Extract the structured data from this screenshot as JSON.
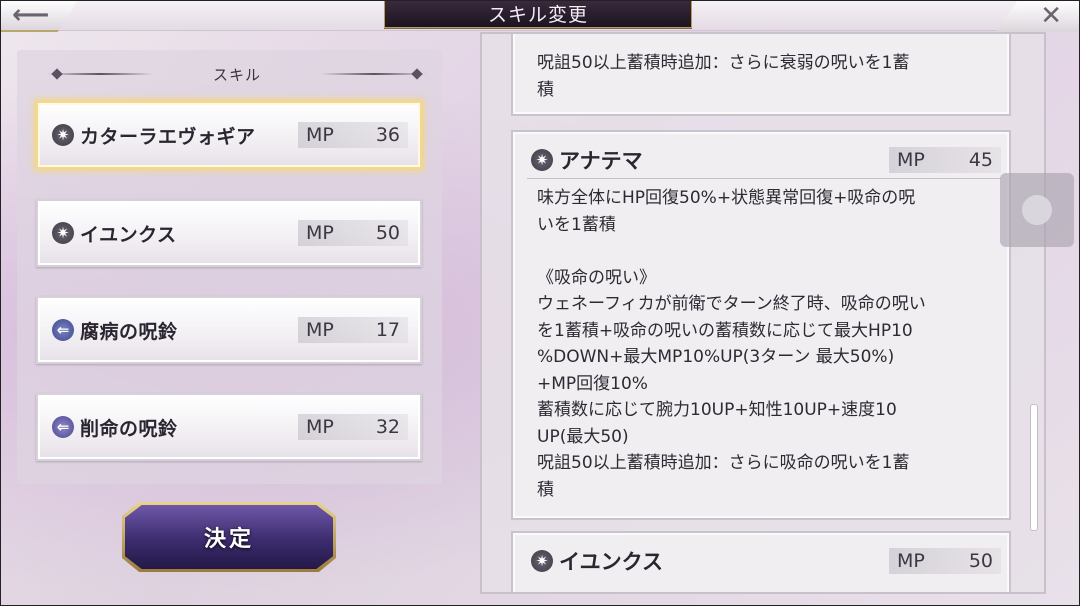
{
  "header": {
    "back_icon": "back-arrow-icon",
    "title": "スキル変更",
    "close_icon": "close-x-icon"
  },
  "left": {
    "section_title": "スキル",
    "skills": [
      {
        "name": "カターラエヴォギア",
        "mp_label": "MP",
        "mp": "36",
        "icon": "star-emblem-icon",
        "selected": true
      },
      {
        "name": "イユンクス",
        "mp_label": "MP",
        "mp": "50",
        "icon": "star-emblem-icon",
        "selected": false
      },
      {
        "name": "腐病の呪鈴",
        "mp_label": "MP",
        "mp": "17",
        "icon": "arrow-left-icon",
        "selected": false
      },
      {
        "name": "削命の呪鈴",
        "mp_label": "MP",
        "mp": "32",
        "icon": "arrow-left-icon",
        "selected": false
      }
    ],
    "decide_label": "決定"
  },
  "right": {
    "prev_card_text": "呪詛50以上蓄積時追加：さらに衰弱の呪いを1蓄\n積",
    "main_card": {
      "name": "アナテマ",
      "mp_label": "MP",
      "mp": "45",
      "description": "味方全体にHP回復50%+状態異常回復+吸命の呪\nいを1蓄積\n\n《吸命の呪い》\nウェネーフィカが前衛でターン終了時、吸命の呪い\nを1蓄積+吸命の呪いの蓄積数に応じて最大HP10\n%DOWN+最大MP10%UP(3ターン 最大50%)\n+MP回復10%\n蓄積数に応じて腕力10UP+知性10UP+速度10\nUP(最大50)\n呪詛50以上蓄積時追加：さらに吸命の呪いを1蓄\n積"
    },
    "next_card": {
      "name": "イユンクス",
      "mp_label": "MP",
      "mp": "50"
    }
  },
  "colors": {
    "selected_glow": "#f3d98c",
    "decide_button": "#3c2c6e",
    "title_plate": "#2a1e2e"
  }
}
